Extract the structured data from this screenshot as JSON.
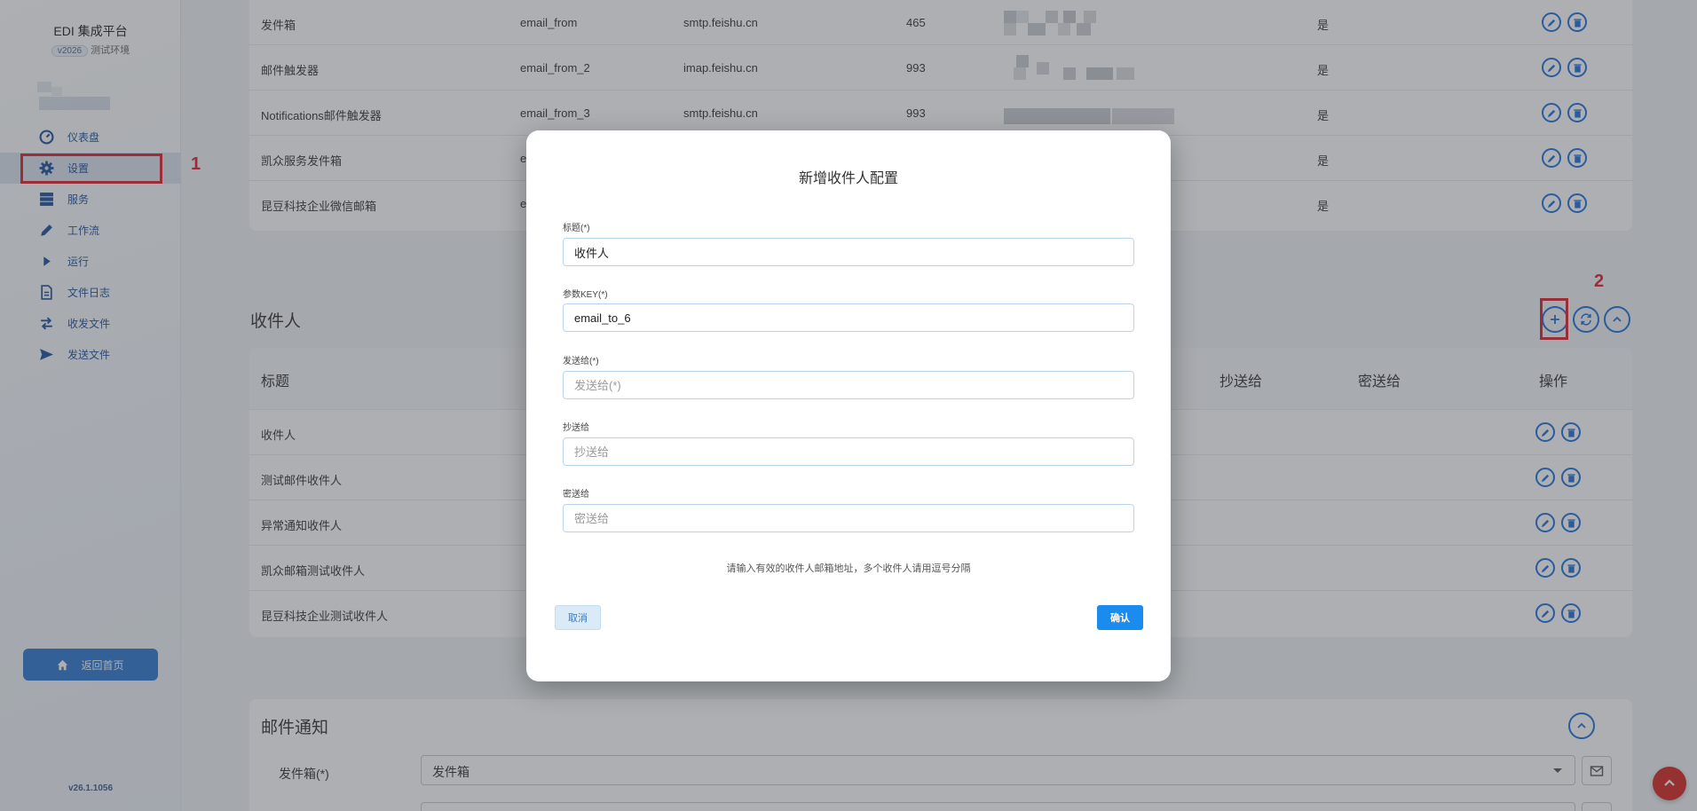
{
  "sidebar": {
    "brand": "EDI 集成平台",
    "version_badge": "v2026",
    "env": "测试环境",
    "items": [
      {
        "label": "仪表盘",
        "icon": "gauge-icon"
      },
      {
        "label": "设置",
        "icon": "gear-icon"
      },
      {
        "label": "服务",
        "icon": "server-icon"
      },
      {
        "label": "工作流",
        "icon": "pencil-icon"
      },
      {
        "label": "运行",
        "icon": "play-icon"
      },
      {
        "label": "文件日志",
        "icon": "file-text-icon"
      },
      {
        "label": "收发文件",
        "icon": "transfer-icon"
      },
      {
        "label": "发送文件",
        "icon": "send-icon"
      }
    ],
    "home_button": "返回首页",
    "footer_version": "v26.1.1056"
  },
  "annotations": {
    "marker1": "1",
    "marker2": "2"
  },
  "sender_table": {
    "rows": [
      {
        "title": "发件箱",
        "key": "email_from",
        "host": "smtp.feishu.cn",
        "port": "465",
        "enabled": "是"
      },
      {
        "title": "邮件触发器",
        "key": "email_from_2",
        "host": "imap.feishu.cn",
        "port": "993",
        "enabled": "是"
      },
      {
        "title": "Notifications邮件触发器",
        "key": "email_from_3",
        "host": "smtp.feishu.cn",
        "port": "993",
        "enabled": "是"
      },
      {
        "title": "凯众服务发件箱",
        "key": "e",
        "host": "",
        "port": "",
        "enabled": "是"
      },
      {
        "title": "昆豆科技企业微信邮箱",
        "key": "e",
        "host": "",
        "port": "",
        "enabled": "是"
      }
    ]
  },
  "recipients": {
    "section_title": "收件人",
    "headers": {
      "title": "标题",
      "cc": "抄送给",
      "bcc": "密送给",
      "actions": "操作"
    },
    "rows": [
      {
        "title": "收件人"
      },
      {
        "title": "测试邮件收件人"
      },
      {
        "title": "异常通知收件人"
      },
      {
        "title": "凯众邮箱测试收件人"
      },
      {
        "title": "昆豆科技企业测试收件人"
      }
    ]
  },
  "mail_notify": {
    "section_title": "邮件通知",
    "sender_label": "发件箱(*)",
    "sender_value": "发件箱"
  },
  "modal": {
    "title": "新增收件人配置",
    "fields": {
      "title_label": "标题(*)",
      "title_value": "收件人",
      "key_label": "参数KEY(*)",
      "key_value": "email_to_6",
      "to_label": "发送给(*)",
      "to_placeholder": "发送给(*)",
      "cc_label": "抄送给",
      "cc_placeholder": "抄送给",
      "bcc_label": "密送给",
      "bcc_placeholder": "密送给"
    },
    "hint": "请输入有效的收件人邮箱地址，多个收件人请用逗号分隔",
    "cancel": "取消",
    "confirm": "确认"
  },
  "colors": {
    "accent": "#1e6fd9",
    "marker": "#e0202a",
    "primary_button": "#1a8cf0"
  }
}
